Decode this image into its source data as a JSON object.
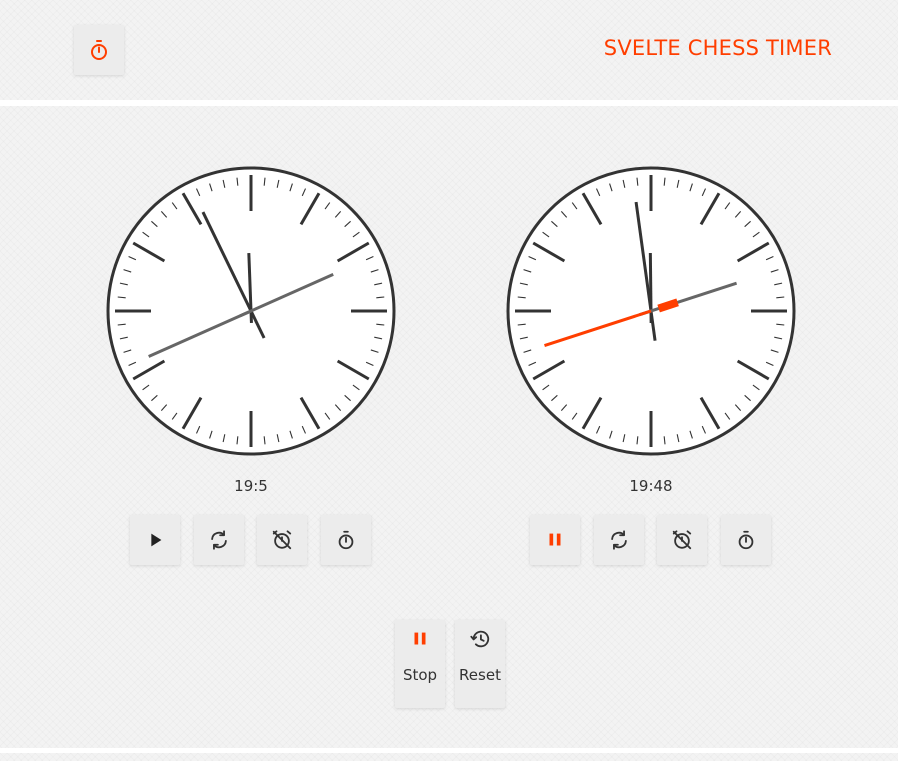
{
  "header": {
    "title": "SVELTE CHESS TIMER",
    "logo_icon": "stopwatch-icon"
  },
  "players": [
    {
      "time_text": "19:5",
      "clock": {
        "hours": 11,
        "minutes": 55,
        "seconds": 41,
        "running": false
      },
      "controls": [
        {
          "icon": "play-icon",
          "state": "paused"
        },
        {
          "icon": "refresh-icon"
        },
        {
          "icon": "alarm-off-icon"
        },
        {
          "icon": "stopwatch-icon"
        }
      ]
    },
    {
      "time_text": "19:48",
      "clock": {
        "hours": 11,
        "minutes": 58,
        "seconds": 42,
        "running": true
      },
      "controls": [
        {
          "icon": "pause-icon",
          "state": "running"
        },
        {
          "icon": "refresh-icon"
        },
        {
          "icon": "alarm-off-icon"
        },
        {
          "icon": "stopwatch-icon"
        }
      ]
    }
  ],
  "actions": {
    "stop_label": "Stop",
    "reset_label": "Reset"
  },
  "colors": {
    "accent": "#ff3e00",
    "icon": "#333333",
    "button_bg": "#ececec"
  }
}
